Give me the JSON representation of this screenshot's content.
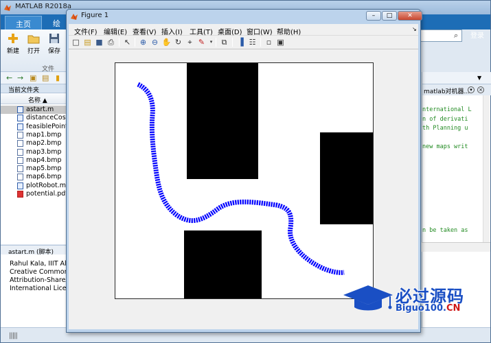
{
  "matlab": {
    "title": "MATLAB R2018a",
    "tabs": {
      "home": "主页",
      "plots": "绘图"
    },
    "login": "登录",
    "ribbon": {
      "new_label": "新建",
      "open_label": "打开",
      "save_label": "保存",
      "group_label": "文件"
    },
    "current_folder_label": "当前文件夹",
    "name_column": "名称 ▲",
    "files": [
      {
        "name": "astart.m",
        "type": "m",
        "selected": true
      },
      {
        "name": "distanceCost.",
        "type": "m",
        "selected": false
      },
      {
        "name": "feasiblePoint.",
        "type": "m",
        "selected": false
      },
      {
        "name": "map1.bmp",
        "type": "bmp",
        "selected": false
      },
      {
        "name": "map2.bmp",
        "type": "bmp",
        "selected": false
      },
      {
        "name": "map3.bmp",
        "type": "bmp",
        "selected": false
      },
      {
        "name": "map4.bmp",
        "type": "bmp",
        "selected": false
      },
      {
        "name": "map5.bmp",
        "type": "bmp",
        "selected": false
      },
      {
        "name": "map6.bmp",
        "type": "bmp",
        "selected": false
      },
      {
        "name": "plotRobot.m",
        "type": "m",
        "selected": false
      },
      {
        "name": "potential.pdf",
        "type": "pdf",
        "selected": false
      }
    ],
    "details_header": "astart.m  (脚本)",
    "details_lines": [
      "Rahul Kala, IIIT Allaha",
      "Creative Commons",
      "Attribution-ShareAlike",
      "International License"
    ],
    "editor_tab": "matlab对机器...",
    "code_lines": [
      "nternational L",
      "n of derivati",
      "th Planning u",
      "",
      "new maps writ",
      "",
      "",
      "",
      "",
      "",
      "",
      "",
      "",
      "n be taken as"
    ]
  },
  "figure": {
    "title": "Figure 1",
    "menus": [
      "文件(F)",
      "编辑(E)",
      "查看(V)",
      "插入(I)",
      "工具(T)",
      "桌面(D)",
      "窗口(W)",
      "帮助(H)"
    ],
    "toolbar_icons": [
      "new-figure-icon",
      "open-file-icon",
      "save-icon",
      "print-icon",
      "pointer-icon",
      "zoom-in-icon",
      "zoom-out-icon",
      "pan-icon",
      "rotate-icon",
      "data-cursor-icon",
      "brush-icon",
      "link-plot-icon",
      "colorbar-icon",
      "legend-icon",
      "hide-plot-tools-icon",
      "show-plot-tools-icon"
    ],
    "colors": {
      "obstacle": "#000000",
      "path": "#0000ff",
      "axes_background": "#ffffff"
    }
  },
  "watermark": {
    "zh": "必过源码",
    "en_main": "Biguo100.",
    "en_suffix": "CN"
  }
}
